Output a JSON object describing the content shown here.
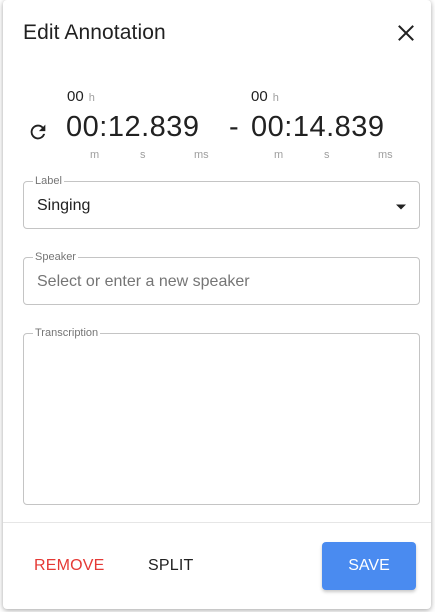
{
  "dialog": {
    "title": "Edit Annotation",
    "close_icon": "close-icon"
  },
  "time": {
    "start": {
      "hours": "00",
      "hours_unit": "h",
      "value": "00:12.839"
    },
    "end": {
      "hours": "00",
      "hours_unit": "h",
      "value": "00:14.839"
    },
    "separator": "-",
    "units": {
      "m": "m",
      "s": "s",
      "ms": "ms"
    },
    "refresh_icon": "refresh-icon"
  },
  "label_field": {
    "legend": "Label",
    "value": "Singing",
    "dropdown_icon": "arrow-drop-down-icon"
  },
  "speaker_field": {
    "legend": "Speaker",
    "value": "",
    "placeholder": "Select or enter a new speaker"
  },
  "transcription_field": {
    "legend": "Transcription",
    "value": ""
  },
  "actions": {
    "remove_label": "REMOVE",
    "split_label": "SPLIT",
    "save_label": "SAVE"
  },
  "colors": {
    "accent": "#4a8bf0",
    "danger": "#e53935",
    "text": "#212121",
    "muted": "#9e9e9e"
  }
}
